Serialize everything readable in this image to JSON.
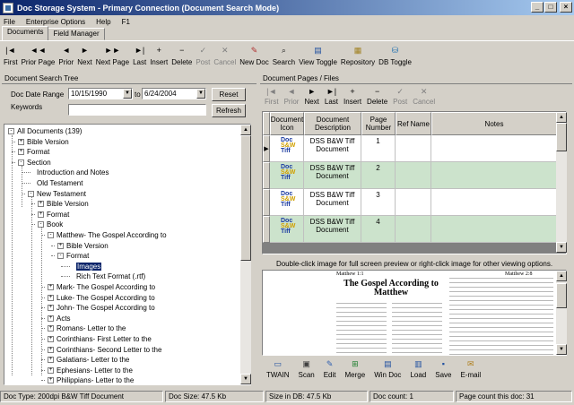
{
  "window": {
    "title": "Doc Storage System - Primary Connection (Document Search Mode)"
  },
  "menu": [
    "File",
    "Enterprise Options",
    "Help",
    "F1"
  ],
  "tabs": [
    "Documents",
    "Field Manager"
  ],
  "toolbar": [
    {
      "label": "First",
      "icon": "first-record-icon",
      "enabled": true
    },
    {
      "label": "Prior Page",
      "icon": "prior-page-icon",
      "enabled": true
    },
    {
      "label": "Prior",
      "icon": "prior-record-icon",
      "enabled": true
    },
    {
      "label": "Next",
      "icon": "next-record-icon",
      "enabled": true
    },
    {
      "label": "Next Page",
      "icon": "next-page-icon",
      "enabled": true
    },
    {
      "label": "Last",
      "icon": "last-record-icon",
      "enabled": true
    },
    {
      "label": "Insert",
      "icon": "plus-icon",
      "enabled": true
    },
    {
      "label": "Delete",
      "icon": "minus-icon",
      "enabled": true
    },
    {
      "label": "Post",
      "icon": "check-icon",
      "enabled": false
    },
    {
      "label": "Cancel",
      "icon": "x-icon",
      "enabled": false
    },
    {
      "label": "New Doc",
      "icon": "new-doc-icon",
      "enabled": true
    },
    {
      "label": "Search",
      "icon": "magnifier-icon",
      "enabled": true
    },
    {
      "label": "View Toggle",
      "icon": "view-toggle-icon",
      "enabled": true
    },
    {
      "label": "Repository",
      "icon": "repository-icon",
      "enabled": true
    },
    {
      "label": "DB Toggle",
      "icon": "db-toggle-icon",
      "enabled": true
    }
  ],
  "search": {
    "panel_title": "Document Search Tree",
    "date_range_label": "Doc Date Range",
    "date_from": "10/15/1990",
    "to_label": "to",
    "date_to": "6/24/2004",
    "keywords_label": "Keywords",
    "keywords_value": "",
    "reset_label": "Reset",
    "refresh_label": "Refresh"
  },
  "tree": [
    {
      "label": "All Documents (139)",
      "level": 0,
      "box": "-"
    },
    {
      "label": "Bible Version",
      "level": 1,
      "box": "+"
    },
    {
      "label": "Format",
      "level": 1,
      "box": "+"
    },
    {
      "label": "Section",
      "level": 1,
      "box": "-"
    },
    {
      "label": "Introduction and Notes",
      "level": 2,
      "box": ""
    },
    {
      "label": "Old Testament",
      "level": 2,
      "box": ""
    },
    {
      "label": "New Testament",
      "level": 2,
      "box": "-"
    },
    {
      "label": "Bible Version",
      "level": 3,
      "box": "+"
    },
    {
      "label": "Format",
      "level": 3,
      "box": "+"
    },
    {
      "label": "Book",
      "level": 3,
      "box": "-"
    },
    {
      "label": "Matthew- The Gospel According to",
      "level": 4,
      "box": "-"
    },
    {
      "label": "Bible Version",
      "level": 5,
      "box": "+"
    },
    {
      "label": "Format",
      "level": 5,
      "box": "-"
    },
    {
      "label": "Images",
      "level": 6,
      "box": "",
      "selected": true
    },
    {
      "label": "Rich Text Format (.rtf)",
      "level": 6,
      "box": ""
    },
    {
      "label": "Mark- The Gospel According to",
      "level": 4,
      "box": "+"
    },
    {
      "label": "Luke- The Gospel According to",
      "level": 4,
      "box": "+"
    },
    {
      "label": "John- The Gospel According to",
      "level": 4,
      "box": "+"
    },
    {
      "label": "Acts",
      "level": 4,
      "box": "+"
    },
    {
      "label": "Romans- Letter to the",
      "level": 4,
      "box": "+"
    },
    {
      "label": "Corinthians- First Letter to the",
      "level": 4,
      "box": "+"
    },
    {
      "label": "Corinthians- Second Letter to the",
      "level": 4,
      "box": "+"
    },
    {
      "label": "Galatians- Letter to the",
      "level": 4,
      "box": "+"
    },
    {
      "label": "Ephesians- Letter to the",
      "level": 4,
      "box": "+"
    },
    {
      "label": "Philippians- Letter to the",
      "level": 4,
      "box": "+"
    }
  ],
  "pages": {
    "panel_title": "Document Pages / Files",
    "toolbar": [
      {
        "label": "First",
        "icon": "first-record-icon",
        "enabled": false
      },
      {
        "label": "Prior",
        "icon": "prior-record-icon",
        "enabled": false
      },
      {
        "label": "Next",
        "icon": "next-record-icon",
        "enabled": true
      },
      {
        "label": "Last",
        "icon": "last-record-icon",
        "enabled": true
      },
      {
        "label": "Insert",
        "icon": "plus-icon",
        "enabled": true
      },
      {
        "label": "Delete",
        "icon": "minus-icon",
        "enabled": true
      },
      {
        "label": "Post",
        "icon": "check-icon",
        "enabled": false
      },
      {
        "label": "Cancel",
        "icon": "x-icon",
        "enabled": false
      }
    ],
    "columns": [
      "Document Icon",
      "Document Description",
      "Page Number",
      "Ref Name",
      "Notes"
    ],
    "icon_text": [
      "Doc",
      "S&W",
      "Tiff"
    ],
    "rows": [
      {
        "description": "DSS B&W Tiff Document",
        "page": "1",
        "ref": "",
        "notes": ""
      },
      {
        "description": "DSS B&W Tiff Document",
        "page": "2",
        "ref": "",
        "notes": ""
      },
      {
        "description": "DSS B&W Tiff Document",
        "page": "3",
        "ref": "",
        "notes": ""
      },
      {
        "description": "DSS B&W Tiff Document",
        "page": "4",
        "ref": "",
        "notes": ""
      }
    ]
  },
  "preview": {
    "hint": "Double-click image for full screen preview or right-click image for other viewing options.",
    "header_left": "Matthew 1:1",
    "header_right": "Matthew 2:8",
    "heading": "The Gospel According to Matthew"
  },
  "bottom_toolbar": [
    {
      "label": "TWAIN",
      "icon": "scanner-icon"
    },
    {
      "label": "Scan",
      "icon": "scan-icon"
    },
    {
      "label": "Edit",
      "icon": "edit-icon"
    },
    {
      "label": "Merge",
      "icon": "merge-icon"
    },
    {
      "label": "Win Doc",
      "icon": "win-doc-icon"
    },
    {
      "label": "Load",
      "icon": "load-icon"
    },
    {
      "label": "Save",
      "icon": "save-icon"
    },
    {
      "label": "E-mail",
      "icon": "email-icon"
    }
  ],
  "status": {
    "doc_type": "Doc Type: 200dpi B&W Tiff Document",
    "doc_size": "Doc Size: 47.5 Kb",
    "db_size": "Size in DB: 47.5 Kb",
    "doc_count": "Doc count: 1",
    "page_count": "Page count this doc: 31"
  },
  "colors": {
    "title_start": "#0a246a",
    "title_end": "#a6caf0",
    "selection": "#0a246a",
    "row_alt": "#cce3cc",
    "face": "#d4d0c8"
  }
}
